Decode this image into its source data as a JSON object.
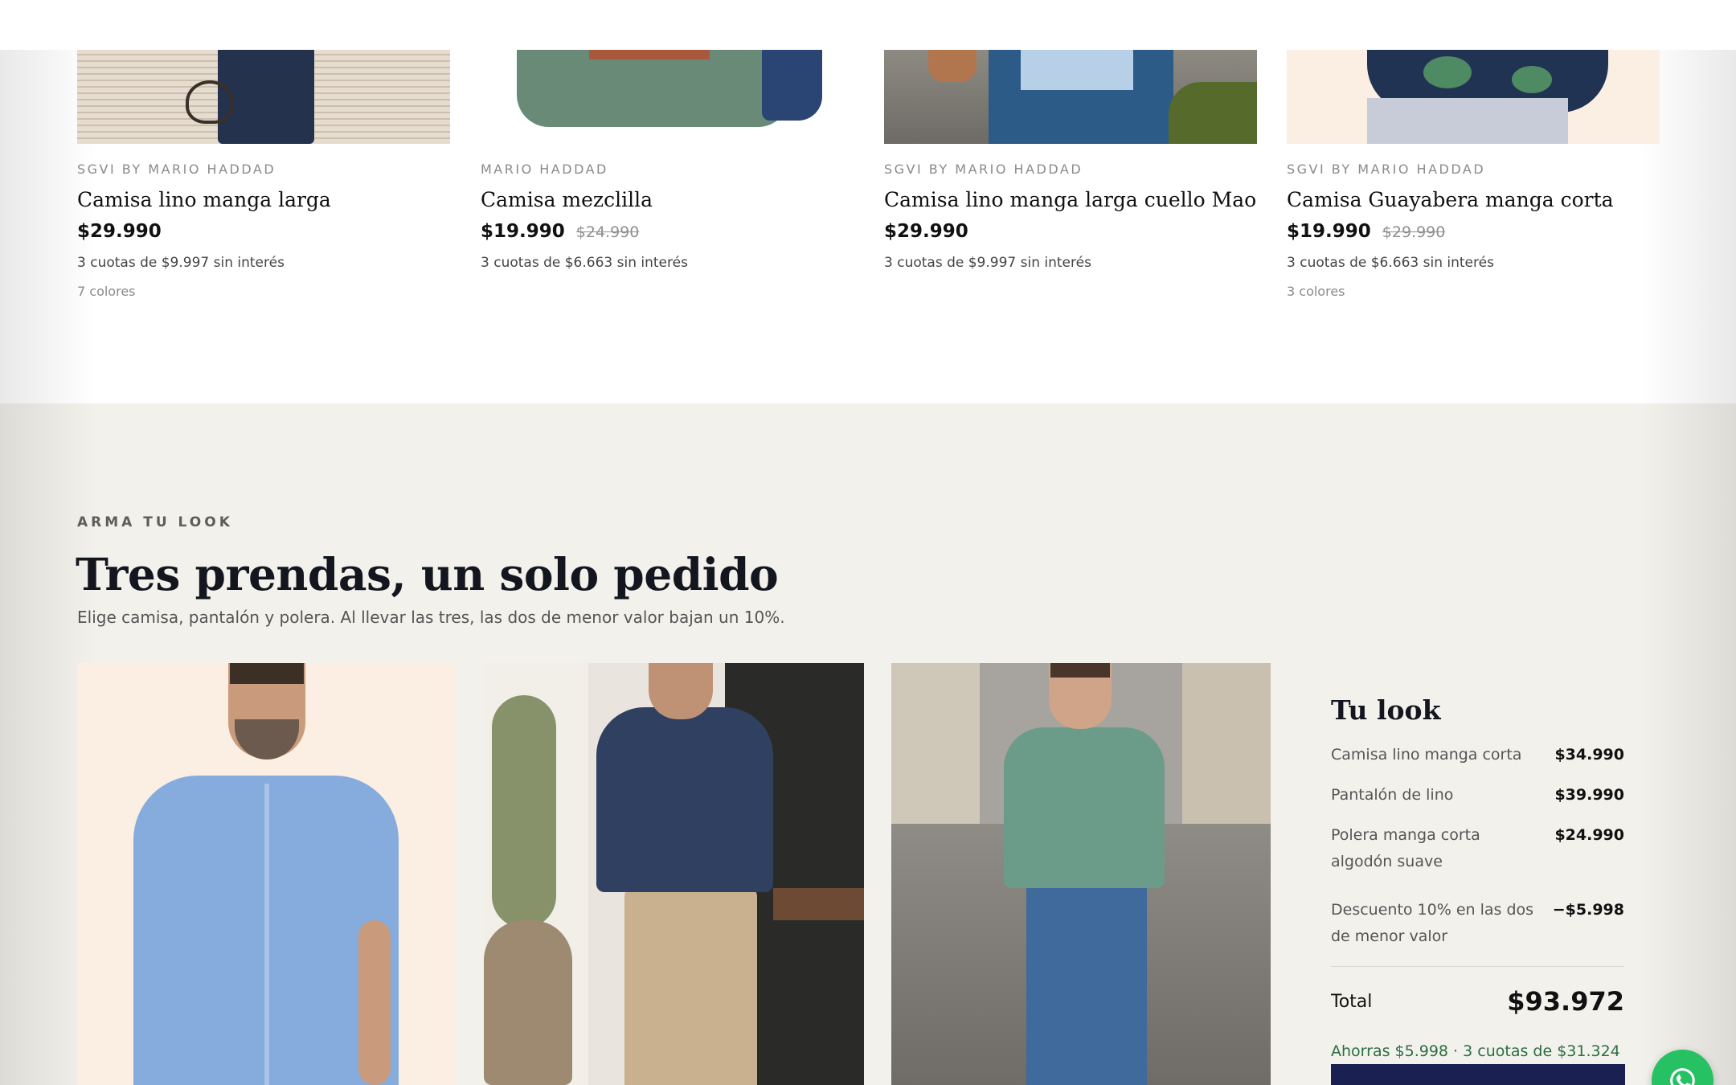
{
  "products": [
    {
      "brand": "SGVI BY MARIO HADDAD",
      "name": "Camisa lino manga larga",
      "price": "$29.990",
      "old_price": "",
      "cuotas": "3 cuotas de $9.997 sin interés",
      "colors": "7 colores"
    },
    {
      "brand": "MARIO HADDAD",
      "name": "Camisa mezclilla",
      "price": "$19.990",
      "old_price": "$24.990",
      "cuotas": "3 cuotas de $6.663 sin interés",
      "colors": ""
    },
    {
      "brand": "SGVI BY MARIO HADDAD",
      "name": "Camisa lino manga larga cuello Mao",
      "price": "$29.990",
      "old_price": "",
      "cuotas": "3 cuotas de $9.997 sin interés",
      "colors": ""
    },
    {
      "brand": "SGVI BY MARIO HADDAD",
      "name": "Camisa Guayabera manga corta",
      "price": "$19.990",
      "old_price": "$29.990",
      "cuotas": "3 cuotas de $6.663 sin interés",
      "colors": "3 colores"
    }
  ],
  "look": {
    "eyebrow": "ARMA TU LOOK",
    "title": "Tres prendas, un solo pedido",
    "subtitle": "Elige camisa, pantalón y polera. Al llevar las tres, las dos de menor valor bajan un 10%.",
    "summary": {
      "heading": "Tu look",
      "items": [
        {
          "label": "Camisa lino manga corta",
          "value": "$34.990"
        },
        {
          "label": "Pantalón de lino",
          "value": "$39.990"
        },
        {
          "label": "Polera manga corta algodón suave",
          "value": "$24.990"
        },
        {
          "label": "Descuento 10% en las dos de menor valor",
          "value": "−$5.998"
        }
      ],
      "total_label": "Total",
      "total_value": "$93.972",
      "savings": "Ahorras $5.998 · 3 cuotas de $31.324"
    }
  },
  "colors": {
    "look_bg": "#f3f1ec",
    "cta": "#1a2150",
    "savings_green": "#2c6d45",
    "whatsapp": "#26c163"
  },
  "icons": {
    "floating_button": "whatsapp-icon"
  }
}
